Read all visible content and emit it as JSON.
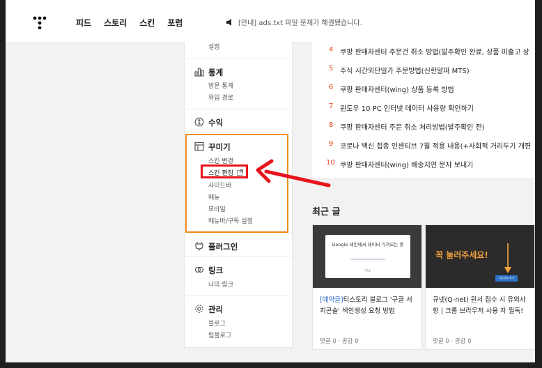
{
  "header": {
    "nav": [
      "피드",
      "스토리",
      "스킨",
      "포럼"
    ],
    "notice": "[안내] ads.txt 파일 문제가 해결됐습니다."
  },
  "sidebar": {
    "top_sub": "설정",
    "stats": {
      "title": "통계",
      "items": [
        "방문 통계",
        "유입 경로"
      ]
    },
    "revenue": {
      "title": "수익"
    },
    "decor": {
      "title": "꾸미기",
      "items": [
        "스킨 변경",
        "스킨 편집",
        "사이드바",
        "메뉴",
        "모바일",
        "메뉴바/구독 설정"
      ]
    },
    "plugin": {
      "title": "플러그인"
    },
    "link": {
      "title": "링크",
      "items": [
        "나의 링크"
      ]
    },
    "manage": {
      "title": "관리",
      "items": [
        "블로그",
        "팀블로그"
      ]
    }
  },
  "popular": [
    {
      "num": "4",
      "text": "쿠팡 판매자센터 주문건 취소 방법(발주확인 완료, 상품 미출고 상"
    },
    {
      "num": "5",
      "text": "주식 시간외단일가 주문방법(신한알파 MTS)"
    },
    {
      "num": "6",
      "text": "쿠팡 판매자센터(wing) 상품 등록 방법"
    },
    {
      "num": "7",
      "text": "윈도우 10 PC 인터넷 데이터 사용량 확인하기"
    },
    {
      "num": "8",
      "text": "쿠팡 판매자센터 주문 취소 처리방법(발주확인 전)"
    },
    {
      "num": "9",
      "text": "코로나 백신 접종 인센티브 7월 적용 내용(+사회적 거리두기 개편"
    },
    {
      "num": "10",
      "text": "쿠팡 판매자센터(wing) 배송지연 문자 보내기"
    }
  ],
  "recent": {
    "title": "최근 글",
    "cards": [
      {
        "thumb_text": "Google 색인에서 데이터 가져오는 중",
        "thumb_btn": "취소",
        "tag": "[예약글]",
        "title": "티스토리 블로그 '구글 서치콘솔' 색인생성 요청 방법",
        "meta": "댓글 0 · 공감 0"
      },
      {
        "thumb_text": "꼭 눌러주세요!",
        "thumb_btn": "지금 접수 하기",
        "tag": "",
        "title": "큐넷(Q-net) 원서 접수 시 유의사항 | 크롬 브라우저 사용 자 필독!",
        "meta": "댓글 0 · 공감 0"
      }
    ]
  },
  "colors": {
    "accent_orange": "#f28b1a",
    "highlight_red": "#e8141b",
    "number_red": "#e8401c",
    "link_blue": "#2a6ac9"
  }
}
